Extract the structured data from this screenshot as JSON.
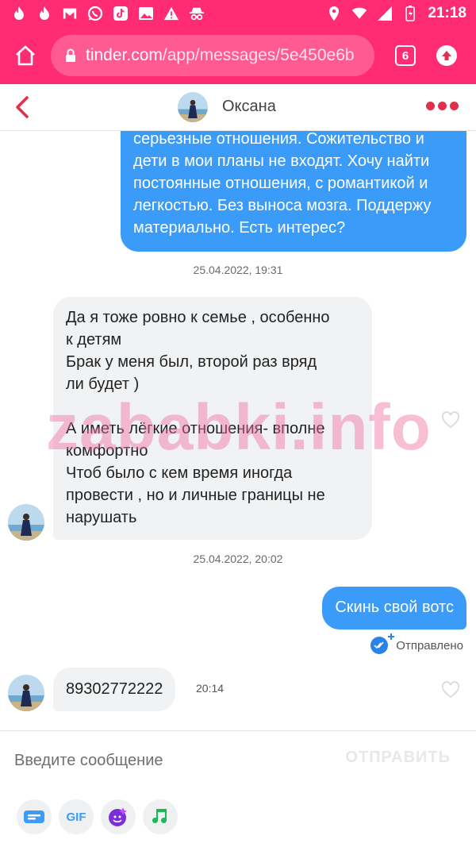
{
  "status_bar": {
    "time": "21:18",
    "icons": [
      "fire-icon",
      "fire-icon",
      "gmail-icon",
      "whatsapp-icon",
      "tiktok-icon",
      "gallery-icon",
      "warning-icon",
      "incognito-icon",
      "location-icon",
      "wifi-icon",
      "signal-icon",
      "battery-charging-icon"
    ]
  },
  "browser": {
    "url_domain": "tinder.com",
    "url_path": "/app/messages/5e450e6b",
    "tab_count": "6"
  },
  "chat_header": {
    "name": "Оксана"
  },
  "messages": [
    {
      "direction": "outgoing",
      "text": "серьезные отношения. Сожительство и дети в мои планы не входят. Хочу найти постоянные отношения, с романтикой и легкостью. Без выноса мозга. Поддержу материально. Есть интерес?"
    },
    {
      "timestamp": "25.04.2022, 19:31"
    },
    {
      "direction": "incoming",
      "lines": [
        "Да я тоже ровно к семье , особенно",
        "к детям",
        "Брак у меня был, второй раз вряд",
        "ли будет )",
        "",
        "А иметь лёгкие отношения- вполне",
        "комфортно",
        "Чтоб было с кем время иногда",
        "провести , но и личные границы не",
        "нарушать"
      ]
    },
    {
      "timestamp": "25.04.2022, 20:02"
    },
    {
      "direction": "outgoing",
      "text": "Скинь свой вотс",
      "status": "Отправлено"
    },
    {
      "direction": "incoming",
      "text": "89302772222",
      "time": "20:14"
    }
  ],
  "watermark": "zababki.info",
  "composer": {
    "placeholder": "Введите сообщение",
    "send_label": "ОТПРАВИТЬ"
  },
  "toolbar": {
    "gif_label": "GIF",
    "tools": [
      "contact-card-icon",
      "gif-icon",
      "sticker-icon",
      "music-icon"
    ]
  },
  "colors": {
    "brand": "#ff2c73",
    "outgoing_bubble": "#3a9bf8",
    "incoming_bubble": "#f0f2f4",
    "accent_red": "#e0304e"
  }
}
